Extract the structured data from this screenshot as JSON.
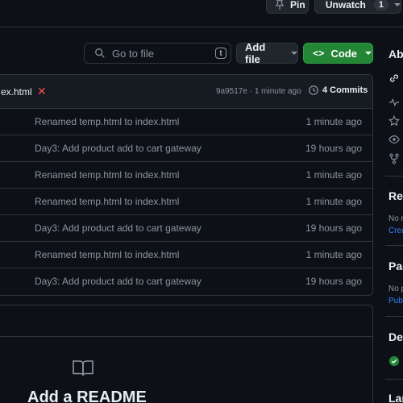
{
  "topbar": {
    "pin_label": "Pin",
    "unwatch_label": "Unwatch",
    "watch_count": "1"
  },
  "toolbar": {
    "search_placeholder": "Go to file",
    "search_shortcut": "t",
    "add_file_label": "Add file",
    "code_label": "Code"
  },
  "file_header": {
    "file_name": "ex.html",
    "commit_hash": "9a9517e · 1 minute ago",
    "commits_label": "4 Commits"
  },
  "rows": [
    {
      "message": "Renamed temp.html to index.html",
      "time": "1 minute ago"
    },
    {
      "message": "Day3: Add product add to cart gateway",
      "time": "19 hours ago"
    },
    {
      "message": "Renamed temp.html to index.html",
      "time": "1 minute ago"
    },
    {
      "message": "Renamed temp.html to index.html",
      "time": "1 minute ago"
    },
    {
      "message": "Day3: Add product add to cart gateway",
      "time": "19 hours ago"
    },
    {
      "message": "Renamed temp.html to index.html",
      "time": "1 minute ago"
    },
    {
      "message": "Day3: Add product add to cart gateway",
      "time": "19 hours ago"
    }
  ],
  "readme": {
    "title": "Add a README"
  },
  "sidebar": {
    "about_heading": "Abo",
    "releases_heading": "Rel",
    "releases_text": "No r",
    "releases_link": "Crea",
    "packages_heading": "Pac",
    "packages_text": "No p",
    "packages_link": "Publ",
    "deployments_heading": "Dep",
    "languages_heading": "Lan"
  },
  "colors": {
    "accent_green": "#238636",
    "link_blue": "#2f81f7",
    "danger_red": "#f85149",
    "background": "#0d1117"
  }
}
